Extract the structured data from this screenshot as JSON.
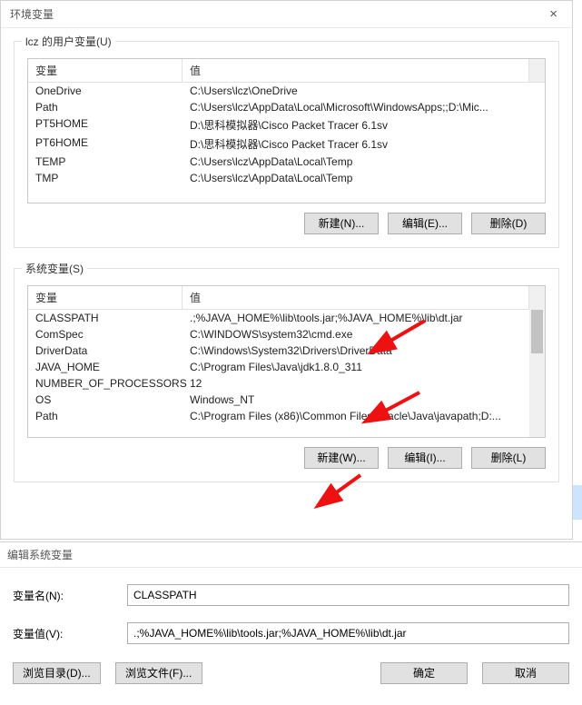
{
  "dialog1": {
    "title": "环境变量",
    "close_label": "×",
    "user_group_label": "lcz 的用户变量(U)",
    "sys_group_label": "系统变量(S)",
    "col_name": "变量",
    "col_value": "值",
    "user_vars": [
      {
        "name": "OneDrive",
        "value": "C:\\Users\\lcz\\OneDrive"
      },
      {
        "name": "Path",
        "value": "C:\\Users\\lcz\\AppData\\Local\\Microsoft\\WindowsApps;;D:\\Mic..."
      },
      {
        "name": "PT5HOME",
        "value": "D:\\思科模拟器\\Cisco Packet Tracer 6.1sv"
      },
      {
        "name": "PT6HOME",
        "value": "D:\\思科模拟器\\Cisco Packet Tracer 6.1sv"
      },
      {
        "name": "TEMP",
        "value": "C:\\Users\\lcz\\AppData\\Local\\Temp"
      },
      {
        "name": "TMP",
        "value": "C:\\Users\\lcz\\AppData\\Local\\Temp"
      }
    ],
    "sys_vars": [
      {
        "name": "CLASSPATH",
        "value": ".;%JAVA_HOME%\\lib\\tools.jar;%JAVA_HOME%\\lib\\dt.jar"
      },
      {
        "name": "ComSpec",
        "value": "C:\\WINDOWS\\system32\\cmd.exe"
      },
      {
        "name": "DriverData",
        "value": "C:\\Windows\\System32\\Drivers\\DriverData"
      },
      {
        "name": "JAVA_HOME",
        "value": "C:\\Program Files\\Java\\jdk1.8.0_311"
      },
      {
        "name": "NUMBER_OF_PROCESSORS",
        "value": "12"
      },
      {
        "name": "OS",
        "value": "Windows_NT"
      },
      {
        "name": "Path",
        "value": "C:\\Program Files (x86)\\Common Files\\Oracle\\Java\\javapath;D:..."
      }
    ],
    "user_buttons": {
      "new": "新建(N)...",
      "edit": "编辑(E)...",
      "delete": "删除(D)"
    },
    "sys_buttons": {
      "new": "新建(W)...",
      "edit": "编辑(I)...",
      "delete": "删除(L)"
    }
  },
  "dialog2": {
    "title": "编辑系统变量",
    "name_label": "变量名(N):",
    "value_label": "变量值(V):",
    "name_value": "CLASSPATH",
    "value_value": ".;%JAVA_HOME%\\lib\\tools.jar;%JAVA_HOME%\\lib\\dt.jar",
    "browse_dir": "浏览目录(D)...",
    "browse_file": "浏览文件(F)...",
    "ok": "确定",
    "cancel": "取消"
  }
}
